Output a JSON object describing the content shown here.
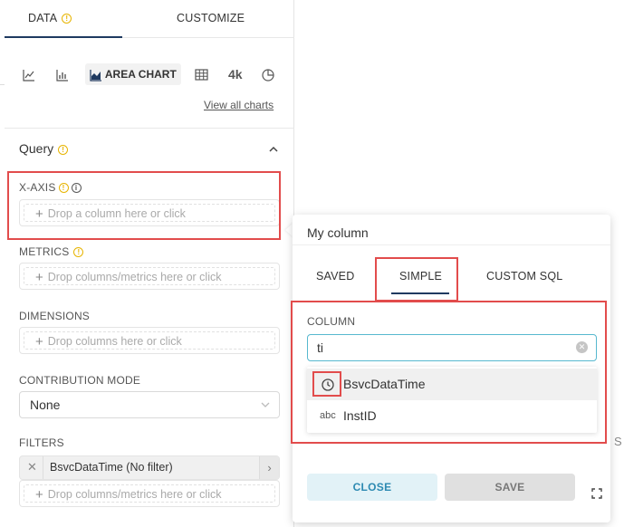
{
  "tabs": {
    "data": "DATA",
    "customize": "CUSTOMIZE"
  },
  "chart_picker": {
    "active": "AREA CHART",
    "big_number": "4k",
    "view_all": "View all charts"
  },
  "query": {
    "title": "Query",
    "x_axis": {
      "label": "X-AXIS",
      "placeholder": "Drop a column here or click"
    },
    "metrics": {
      "label": "METRICS",
      "placeholder": "Drop columns/metrics here or click"
    },
    "dimensions": {
      "label": "DIMENSIONS",
      "placeholder": "Drop columns here or click"
    },
    "contribution": {
      "label": "CONTRIBUTION MODE",
      "value": "None"
    },
    "filters": {
      "label": "FILTERS",
      "tag": "BsvcDataTime (No filter)",
      "placeholder": "Drop columns/metrics here or click"
    }
  },
  "popover": {
    "title": "My column",
    "tabs": [
      "SAVED",
      "SIMPLE",
      "CUSTOM SQL"
    ],
    "column_label": "COLUMN",
    "search_value": "ti",
    "options": [
      {
        "type_icon": "clock-icon",
        "label": "BsvcDataTime"
      },
      {
        "type_icon": "abc",
        "label": "InstID"
      }
    ],
    "close": "CLOSE",
    "save": "SAVE"
  },
  "background_char": "S",
  "colors": {
    "accent": "#1f3a60",
    "highlight_border": "#e24c4c",
    "close_text": "#2d8ab2",
    "warning": "#e7b400"
  }
}
